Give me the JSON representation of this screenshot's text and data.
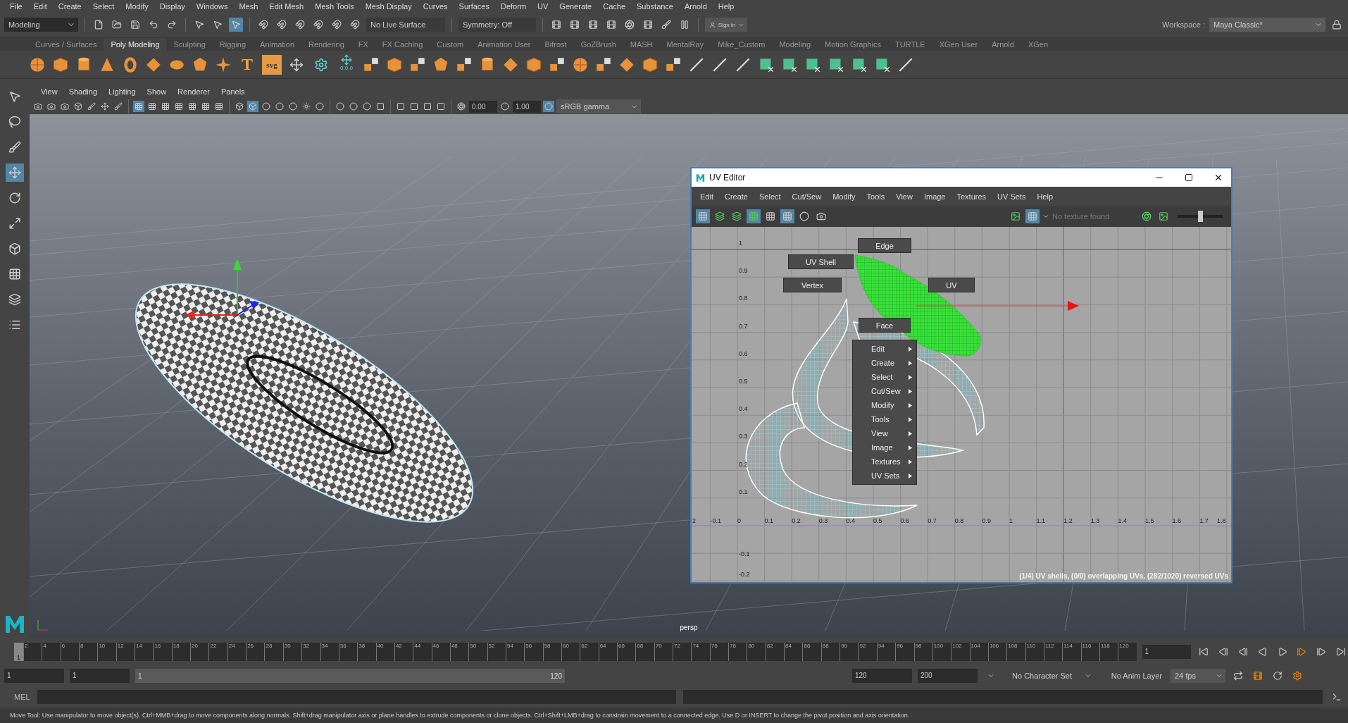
{
  "menu_bar": [
    "File",
    "Edit",
    "Create",
    "Select",
    "Modify",
    "Display",
    "Windows",
    "Mesh",
    "Edit Mesh",
    "Mesh Tools",
    "Mesh Display",
    "Curves",
    "Surfaces",
    "Deform",
    "UV",
    "Generate",
    "Cache",
    "Substance",
    "Arnold",
    "Help"
  ],
  "status_line": {
    "mode": "Modeling",
    "live_surface": "No Live Surface",
    "symmetry": "Symmetry: Off",
    "sign_in": "Sign in",
    "workspace_label": "Workspace :",
    "workspace": "Maya Classic*"
  },
  "shelf": {
    "tabs": [
      {
        "label": "Curves / Surfaces",
        "selected": false
      },
      {
        "label": "Poly Modeling",
        "selected": true
      },
      {
        "label": "Sculpting",
        "selected": false
      },
      {
        "label": "Rigging",
        "selected": false
      },
      {
        "label": "Animation",
        "selected": false
      },
      {
        "label": "Rendering",
        "selected": false
      },
      {
        "label": "FX",
        "selected": false
      },
      {
        "label": "FX Caching",
        "selected": false
      },
      {
        "label": "Custom",
        "selected": false
      },
      {
        "label": "Animation User",
        "selected": false
      },
      {
        "label": "Bifrost",
        "selected": false
      },
      {
        "label": "GoZBrush",
        "selected": false
      },
      {
        "label": "MASH",
        "selected": false
      },
      {
        "label": "MentalRay",
        "selected": false
      },
      {
        "label": "Mike_Custom",
        "selected": false
      },
      {
        "label": "Modeling",
        "selected": false
      },
      {
        "label": "Motion Graphics",
        "selected": false
      },
      {
        "label": "TURTLE",
        "selected": false
      },
      {
        "label": "XGen User",
        "selected": false
      },
      {
        "label": "Arnold",
        "selected": false
      },
      {
        "label": "XGen",
        "selected": false
      }
    ],
    "text_tools": [
      "T",
      "svg"
    ],
    "reset_label": "0,0,0"
  },
  "panel_menu": [
    "View",
    "Shading",
    "Lighting",
    "Show",
    "Renderer",
    "Panels"
  ],
  "panel_toolbar": {
    "exposure": "0.00",
    "gamma": "1.00",
    "color_space": "sRGB gamma"
  },
  "viewport": {
    "camera": "persp"
  },
  "uv_editor": {
    "title": "UV Editor",
    "menus": [
      "Edit",
      "Create",
      "Select",
      "Cut/Sew",
      "Modify",
      "Tools",
      "View",
      "Image",
      "Textures",
      "UV Sets",
      "Help"
    ],
    "texture": "No texture found",
    "slider": {
      "level": 0.5
    },
    "x_ticks": [
      "2",
      "-0.1",
      "0",
      "0.1",
      "0.2",
      "0.3",
      "0.4",
      "0.5",
      "0.6",
      "0.7",
      "0.8",
      "0.9",
      "1",
      "1.1",
      "1.2",
      "1.3",
      "1.4",
      "1.5",
      "1.6",
      "1.7",
      "1.8"
    ],
    "y_ticks": [
      "1",
      "0.9",
      "0.8",
      "0.7",
      "0.6",
      "0.5",
      "0.4",
      "0.3",
      "0.2",
      "0.1",
      "-0.1",
      "-0.2"
    ],
    "component_modes": [
      {
        "kind": "edge",
        "label": "Edge"
      },
      {
        "kind": "shell",
        "label": "UV Shell"
      },
      {
        "kind": "vertex",
        "label": "Vertex"
      },
      {
        "kind": "uv",
        "label": "UV"
      },
      {
        "kind": "face",
        "label": "Face"
      }
    ],
    "marking_menu": [
      "Edit",
      "Create",
      "Select",
      "Cut/Sew",
      "Modify",
      "Tools",
      "View",
      "Image",
      "Textures",
      "UV Sets"
    ],
    "status": "(1/4) UV shells, (0/0) overlapping UVs, (282/1020) reversed UVs"
  },
  "timeline": {
    "level": 0,
    "current_frame": "1",
    "frame_labels": [
      "2",
      "4",
      "6",
      "8",
      "10",
      "12",
      "14",
      "16",
      "18",
      "20",
      "22",
      "24",
      "26",
      "28",
      "30",
      "32",
      "34",
      "36",
      "38",
      "40",
      "42",
      "44",
      "46",
      "48",
      "50",
      "52",
      "54",
      "56",
      "58",
      "60",
      "62",
      "64",
      "66",
      "68",
      "70",
      "72",
      "74",
      "76",
      "78",
      "80",
      "82",
      "84",
      "86",
      "88",
      "90",
      "92",
      "94",
      "96",
      "98",
      "100",
      "102",
      "104",
      "106",
      "108",
      "110",
      "112",
      "114",
      "116",
      "118",
      "120"
    ],
    "current_field": "1"
  },
  "range": {
    "level": 1,
    "start": "1",
    "playback_start": "1",
    "slider_start": "1",
    "slider_end": "120",
    "playback_end": "120",
    "end": "200",
    "character_set": "No Character Set",
    "anim_layer": "No Anim Layer",
    "fps": "24 fps"
  },
  "command_line": {
    "language": "MEL"
  },
  "help_line": "Move Tool: Use manipulator to move object(s). Ctrl+MMB+drag to move components along normals. Shift+drag manipulator axis or plane handles to extrude components or clone objects. Ctrl+Shift+LMB+drag to constrain movement to a connected edge. Use D or INSERT to change the pivot position and axis orientation."
}
